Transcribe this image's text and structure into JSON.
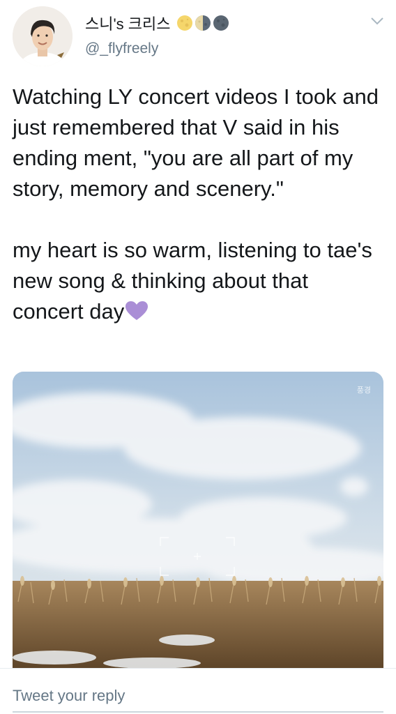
{
  "tweet": {
    "display_name": "스니's 크리스",
    "handle": "@_flyfreely",
    "text": "Watching LY concert videos I took and just remembered that V said in his ending ment, \"you are all part of my story, memory and scenery.\"\n\nmy heart is so warm, listening to tae's new song & thinking about that concert day",
    "emoji": "purple-heart",
    "moon_icons": [
      "full-moon-icon",
      "last-quarter-moon-icon",
      "new-moon-icon"
    ],
    "media_watermark": "풍경"
  },
  "reply": {
    "placeholder": "Tweet your reply"
  },
  "colors": {
    "text": "#14171a",
    "secondary": "#657786",
    "heart": "#aa8ed6",
    "sky": "#b9cfe4",
    "reeds": "#7a5a36"
  }
}
